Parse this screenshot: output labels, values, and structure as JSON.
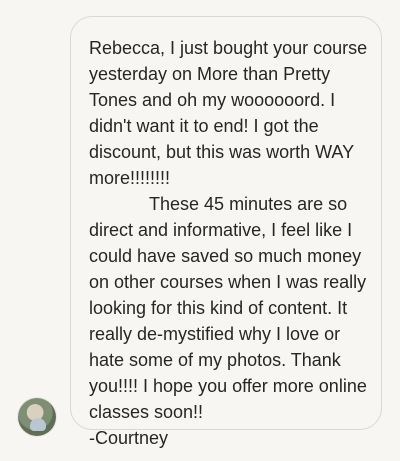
{
  "conversation": {
    "sender": {
      "avatar_icon": "user-avatar-icon"
    },
    "message": {
      "text": "Rebecca, I just bought your course yesterday on More than Pretty Tones and oh my woooooord. I didn't want it to end! I got the discount, but this was worth WAY more!!!!!!!!\n            These 45 minutes are so direct and informative, I feel like I could have saved so much money on other courses when I was really looking for this kind of content. It really de-mystified why I love or hate some of my photos. Thank you!!!! I hope you offer more online classes soon!!\n-Courtney"
    }
  },
  "colors": {
    "background": "#f7f6f2",
    "bubble_border": "#d8d8d8",
    "text": "#262626"
  }
}
